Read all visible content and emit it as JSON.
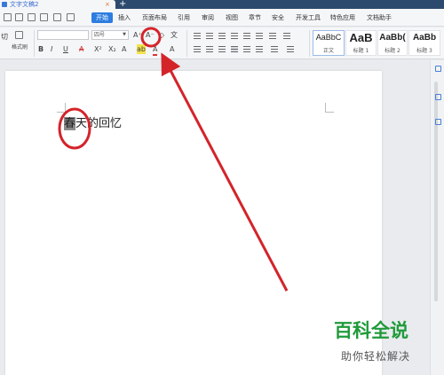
{
  "titlebar": {
    "doc_tab_title": "文字文稿2",
    "close_glyph": "×",
    "new_tab_glyph": "+"
  },
  "menu": {
    "active_tab": "开始",
    "tabs": [
      "插入",
      "页面布局",
      "引用",
      "审阅",
      "视图",
      "章节",
      "安全",
      "开发工具",
      "特色应用",
      "文档助手"
    ]
  },
  "ribbon": {
    "paste_partial": "切",
    "format_painter": "格式刷",
    "font_size": "四号",
    "bold": "B",
    "italic": "I",
    "underline": "U",
    "styles": [
      {
        "sample": "AaBbC",
        "name": "正文"
      },
      {
        "sample": "AaB",
        "name": "标题 1"
      },
      {
        "sample": "AaBb(",
        "name": "标题 2"
      },
      {
        "sample": "AaBb",
        "name": "标题 3"
      }
    ]
  },
  "document": {
    "selected_char": "春",
    "rest_text": "天的回忆"
  },
  "watermark": {
    "main": "百科全说",
    "sub": "助你轻松解决"
  },
  "colors": {
    "accent": "#2d7de0",
    "annotation": "#d3242a",
    "watermark": "#1f9a3a"
  }
}
